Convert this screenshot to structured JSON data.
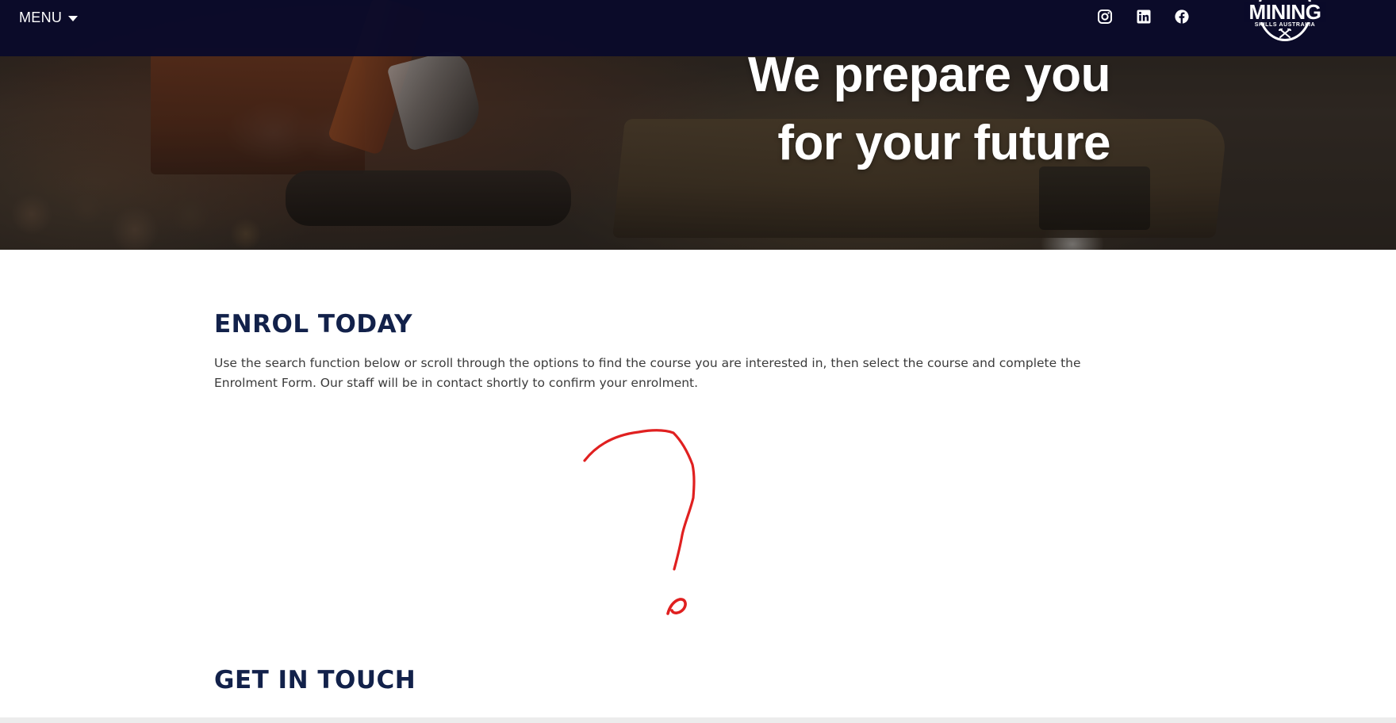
{
  "header": {
    "menu_label": "MENU",
    "social": [
      "instagram-icon",
      "linkedin-icon",
      "facebook-icon"
    ],
    "logo": {
      "word": "MINING",
      "sub": "SKILLS AUSTRALIA"
    }
  },
  "hero": {
    "heading_line1": "We prepare you",
    "heading_line2": "for your future"
  },
  "enrol": {
    "title": "ENROL TODAY",
    "description": "Use the search function below or scroll through the options to find the course you are interested in, then select the course and complete the Enrolment Form. Our staff will be in contact shortly to confirm your enrolment."
  },
  "contact": {
    "title": "GET IN TOUCH"
  },
  "colors": {
    "header_bg": "#0a0a2a",
    "heading_navy": "#12214a",
    "annotation_red": "#e02020",
    "body_text": "#3b3b3b"
  }
}
